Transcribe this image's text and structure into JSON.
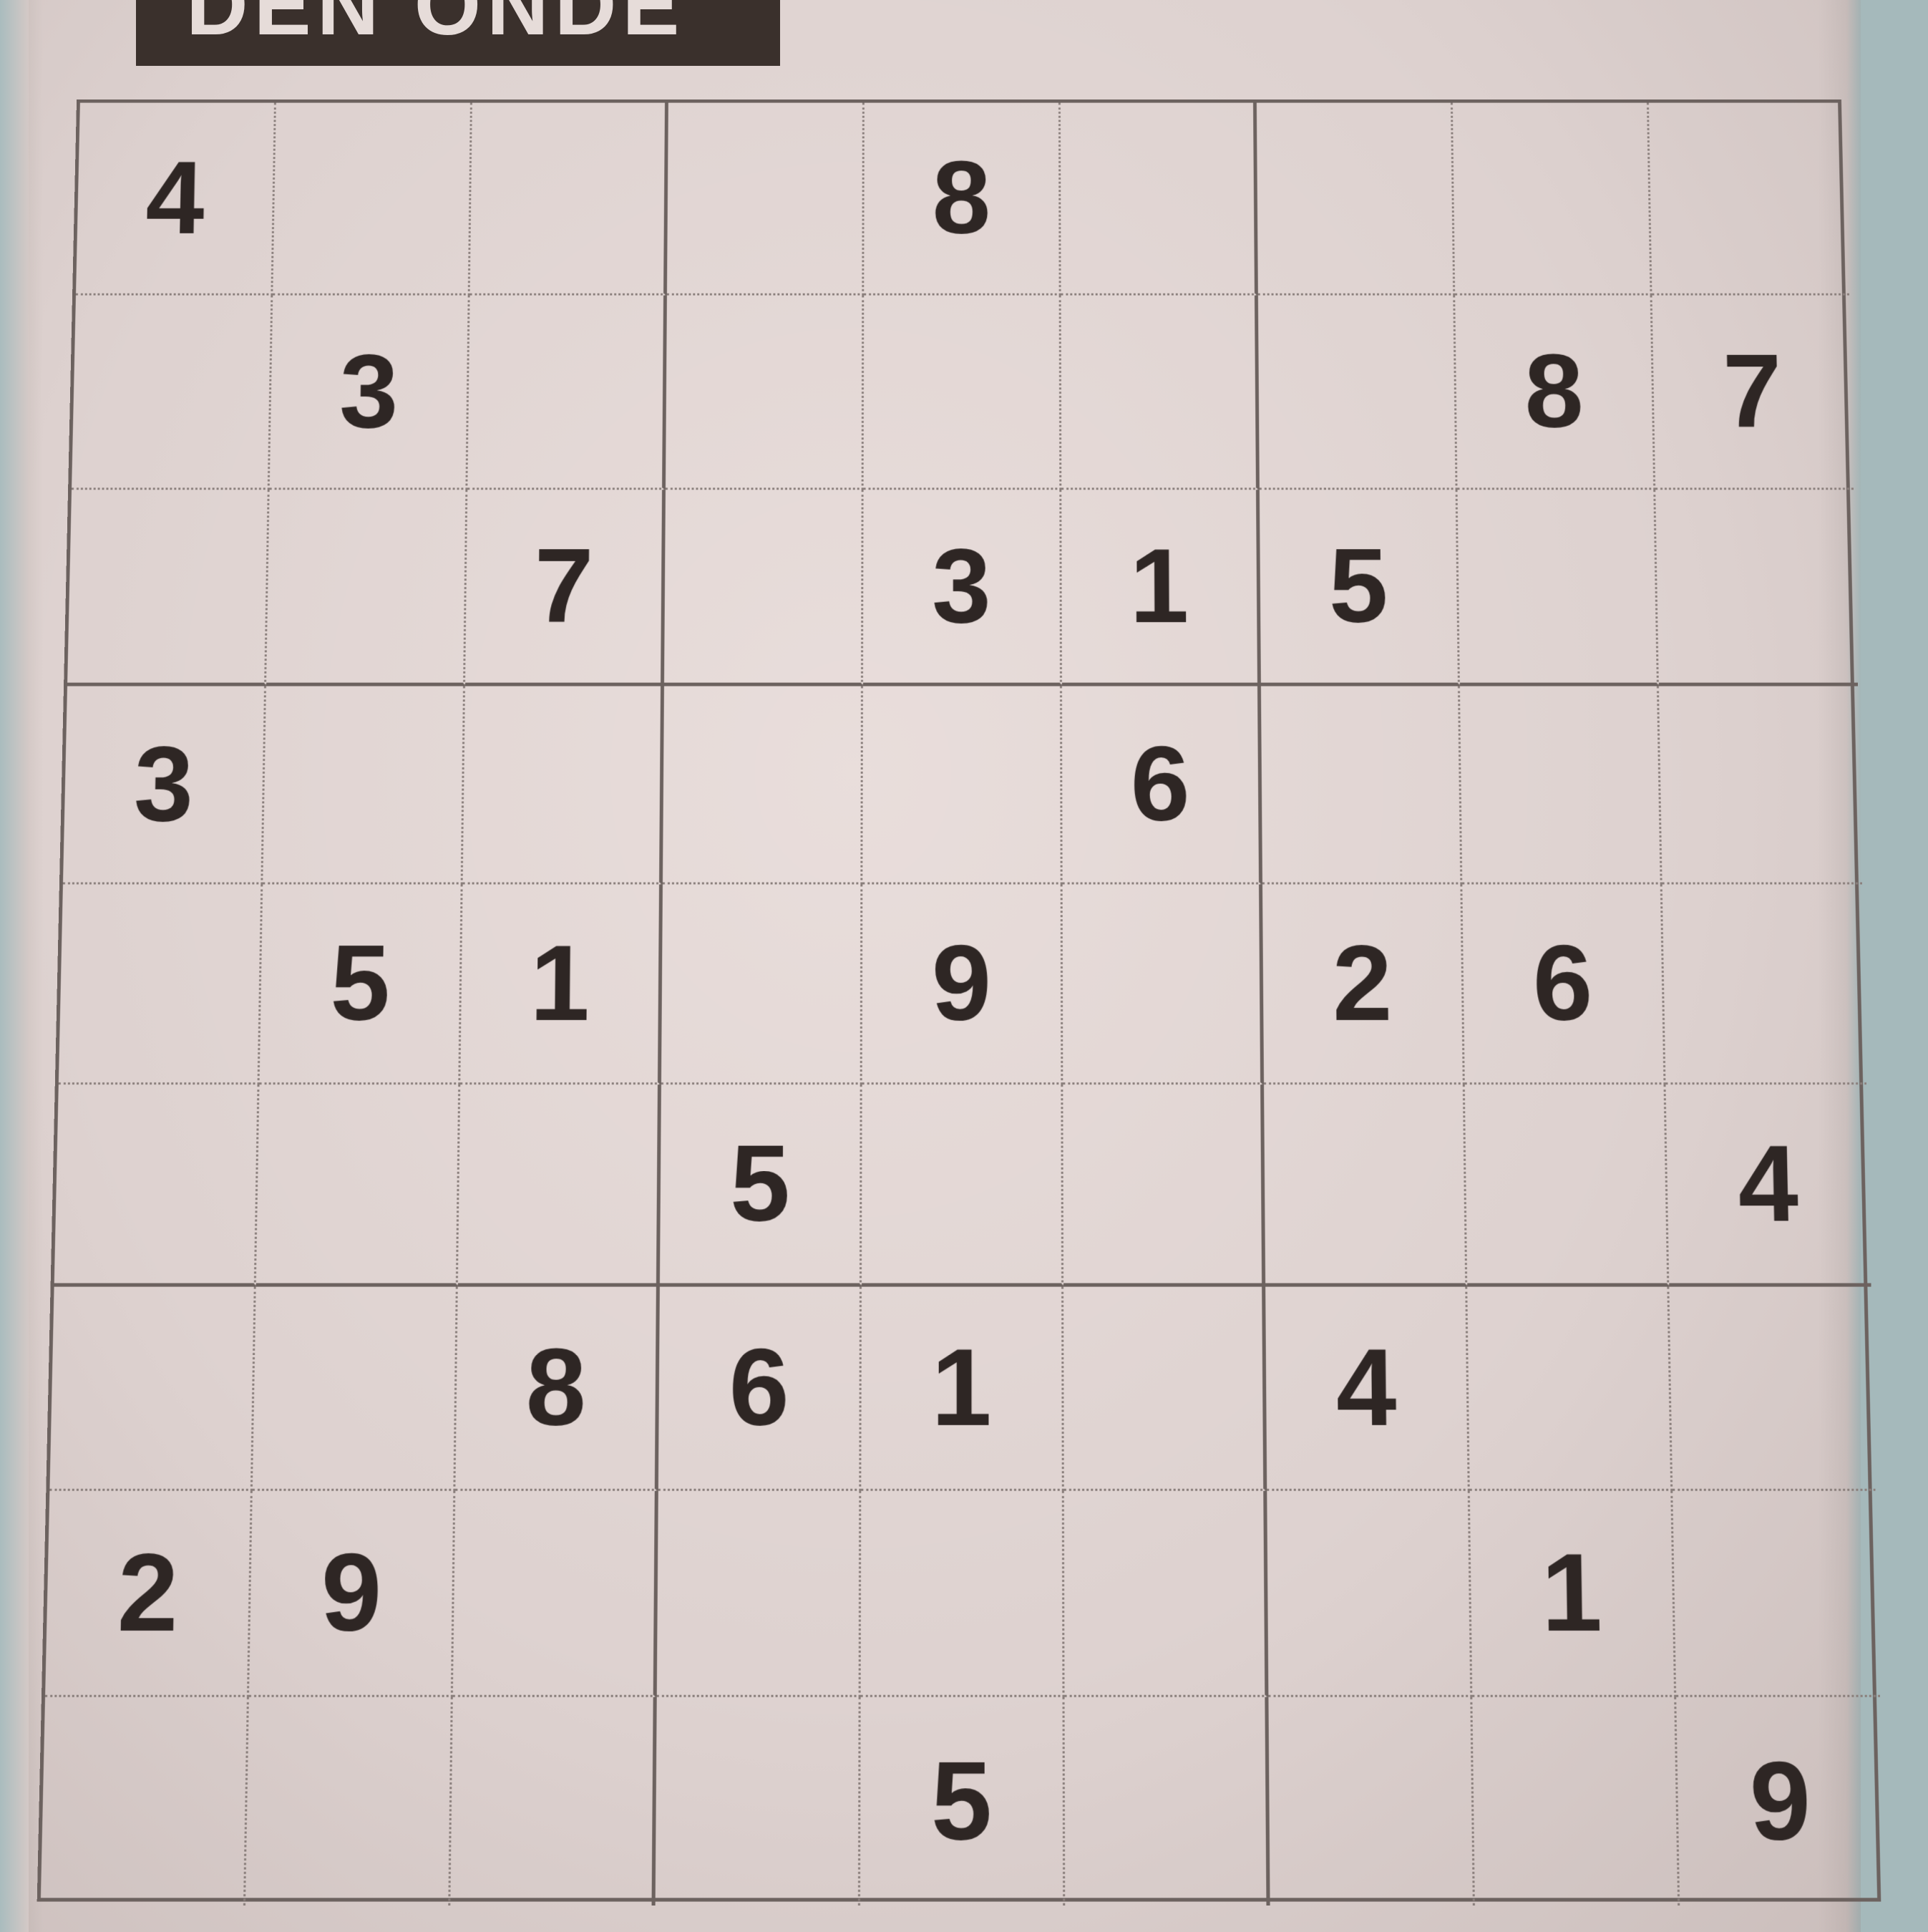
{
  "header": {
    "title": "DEN ONDE"
  },
  "puzzle": {
    "grid": [
      [
        "4",
        "",
        "",
        "",
        "8",
        "",
        "",
        "",
        ""
      ],
      [
        "",
        "3",
        "",
        "",
        "",
        "",
        "",
        "8",
        "7"
      ],
      [
        "",
        "",
        "7",
        "",
        "3",
        "1",
        "5",
        "",
        ""
      ],
      [
        "3",
        "",
        "",
        "",
        "",
        "6",
        "",
        "",
        ""
      ],
      [
        "",
        "5",
        "1",
        "",
        "9",
        "",
        "2",
        "6",
        ""
      ],
      [
        "",
        "",
        "",
        "5",
        "",
        "",
        "",
        "",
        "4"
      ],
      [
        "",
        "",
        "8",
        "6",
        "1",
        "",
        "4",
        "",
        ""
      ],
      [
        "2",
        "9",
        "",
        "",
        "",
        "",
        "",
        "1",
        ""
      ],
      [
        "",
        "",
        "",
        "",
        "5",
        "",
        "",
        "",
        "9"
      ]
    ]
  }
}
